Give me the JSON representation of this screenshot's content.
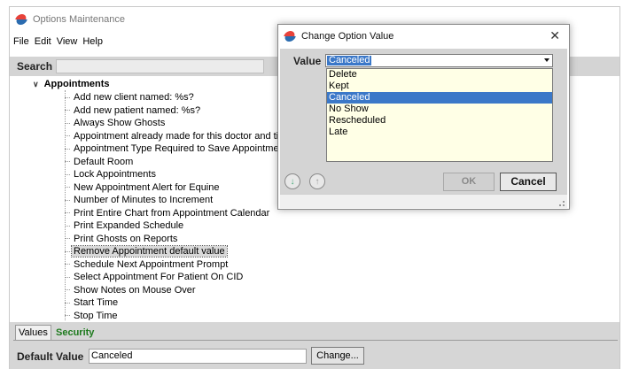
{
  "main_window": {
    "title": "Options Maintenance",
    "menu": [
      "File",
      "Edit",
      "View",
      "Help"
    ]
  },
  "search": {
    "label": "Search",
    "value": ""
  },
  "tree": {
    "root_label": "Appointments",
    "items": [
      "Add new client named: %s?",
      "Add new patient named: %s?",
      "Always Show Ghosts",
      "Appointment already made for this doctor and time.",
      "Appointment Type Required to Save Appointment",
      "Default Room",
      "Lock Appointments",
      "New Appointment Alert for Equine",
      "Number of Minutes to Increment",
      "Print Entire Chart from Appointment Calendar",
      "Print Expanded Schedule",
      "Print Ghosts on Reports",
      "Remove Appointment default value",
      "Schedule Next Appointment Prompt",
      "Select Appointment For Patient On CID",
      "Show Notes on Mouse Over",
      "Start Time",
      "Stop Time"
    ],
    "selected_index": 12
  },
  "tabs": {
    "values": "Values",
    "security": "Security"
  },
  "default_value": {
    "label": "Default Value",
    "value": "Canceled",
    "change_button": "Change..."
  },
  "dialog": {
    "title": "Change Option Value",
    "value_label": "Value",
    "selected": "Canceled",
    "options": [
      "Delete",
      "Kept",
      "Canceled",
      "No Show",
      "Rescheduled",
      "Late"
    ],
    "highlighted_index": 2,
    "ok": "OK",
    "cancel": "Cancel"
  },
  "colors": {
    "selection_blue": "#3b78c8",
    "security_tab_green": "#1d7a1d",
    "dropdown_bg": "#ffffe6"
  }
}
